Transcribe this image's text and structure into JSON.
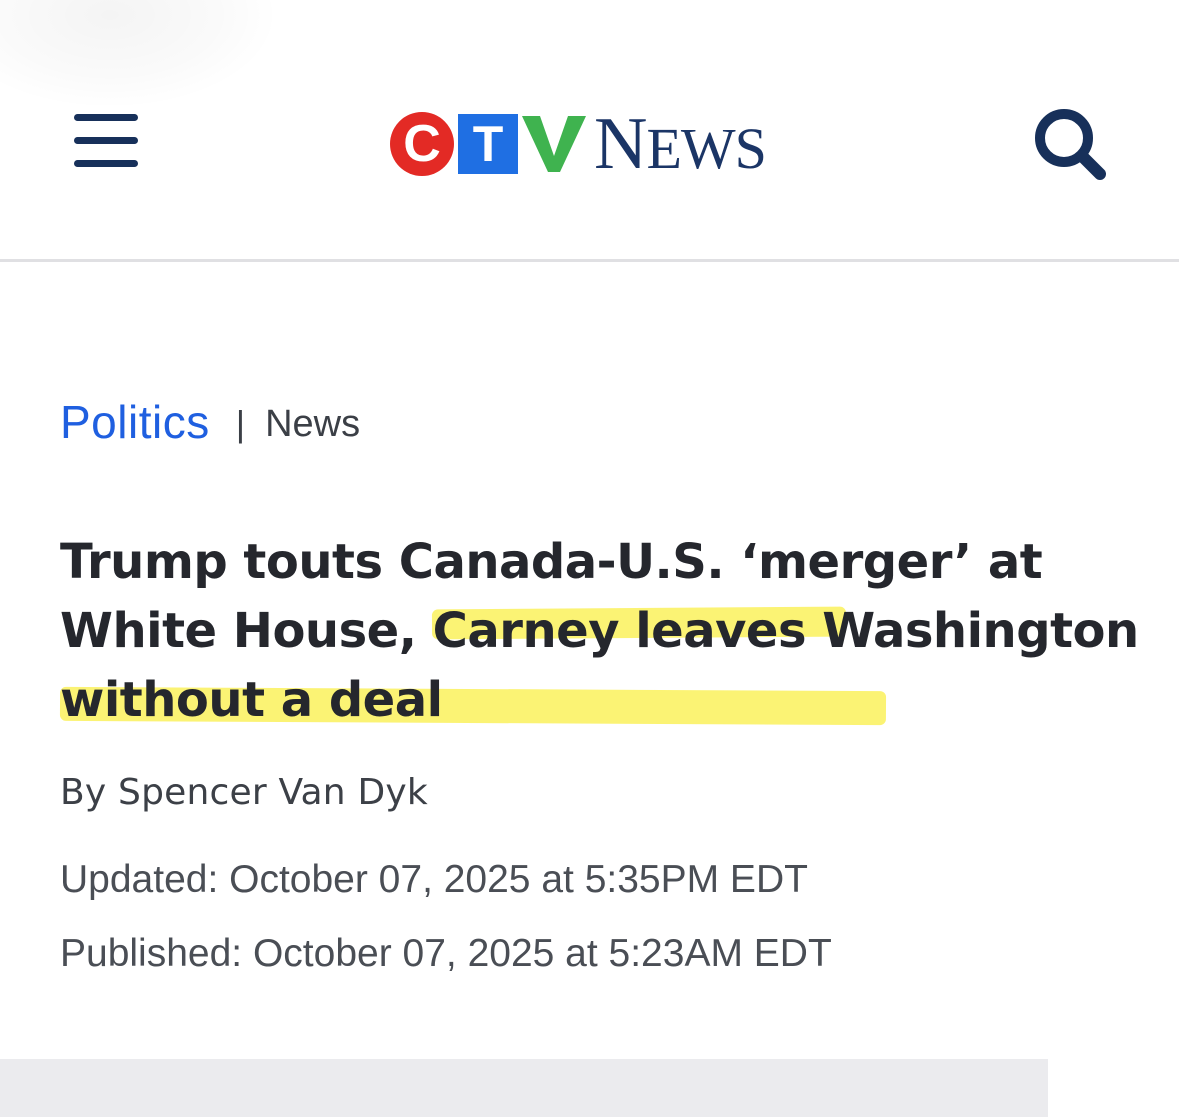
{
  "header": {
    "logo": {
      "letters": [
        "C",
        "T",
        "V"
      ],
      "wordmark_first": "N",
      "wordmark_rest": "EWS",
      "colors": {
        "c_red": "#e32a25",
        "t_blue": "#1f6fe3",
        "v_green": "#3fb34f",
        "news_navy": "#1b3566"
      }
    },
    "menu_icon": "hamburger-menu-icon",
    "search_icon": "search-icon",
    "icon_color": "#17305a"
  },
  "article": {
    "section": "Politics",
    "separator": "|",
    "category": "News",
    "headline_part1": "Trump touts Canada-U.S. ‘merger’ at White House, C",
    "headline_part2": "arney leaves Washington without a deal",
    "highlight_color": "#fbf26d",
    "byline": "By Spencer Van Dyk",
    "updated": "Updated: October 07, 2025 at 5:35PM EDT",
    "published": "Published: October 07, 2025 at 5:23AM EDT",
    "link_color": "#1f5fe0"
  }
}
